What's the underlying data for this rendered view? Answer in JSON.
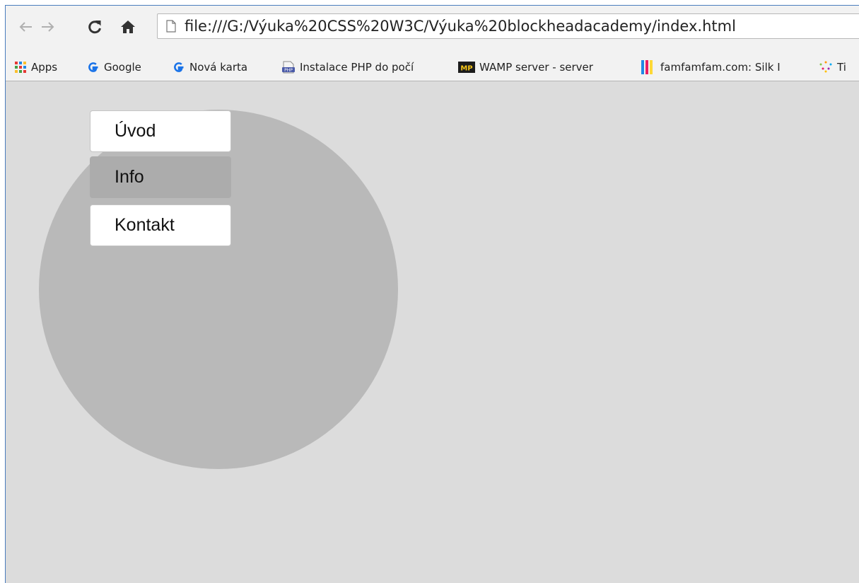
{
  "browser": {
    "url": "file:///G:/Výuka%20CSS%20W3C/Výuka%20blockheadacademy/index.html",
    "bookmarks": [
      {
        "label": "Apps",
        "icon": "apps-grid-icon"
      },
      {
        "label": "Google",
        "icon": "google-icon"
      },
      {
        "label": "Nová karta",
        "icon": "google-icon"
      },
      {
        "label": "Instalace PHP do počí",
        "icon": "php-icon"
      },
      {
        "label": "WAMP server - server",
        "icon": "wamp-icon"
      },
      {
        "label": "famfamfam.com: Silk I",
        "icon": "famfamfam-icon"
      },
      {
        "label": "Ti",
        "icon": "sparkle-icon"
      }
    ]
  },
  "page": {
    "menu": [
      {
        "label": "Úvod",
        "state": "normal"
      },
      {
        "label": "Info",
        "state": "hover"
      },
      {
        "label": "Kontakt",
        "state": "normal"
      }
    ],
    "colors": {
      "background": "#dcdcdc",
      "circle": "#b9b9b9",
      "menu_item": "#ffffff",
      "menu_item_hover": "#acacac"
    }
  }
}
